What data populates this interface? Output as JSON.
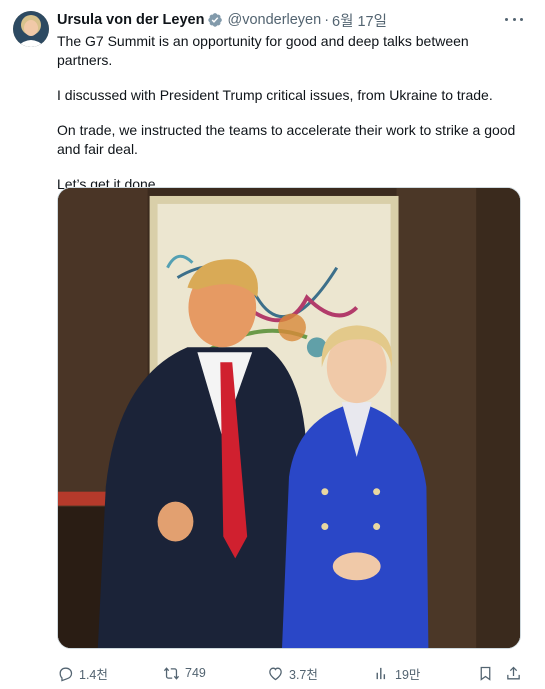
{
  "author": {
    "name": "Ursula von der Leyen",
    "handle": "@vonderleyen",
    "separator": "·",
    "date": "6월 17일",
    "verified_icon": "verified-badge-icon"
  },
  "tweet": {
    "paragraphs": [
      "The G7 Summit is an opportunity for good and deep talks between partners.",
      "I discussed with President Trump critical issues, from Ukraine to trade.",
      "On trade, we instructed the teams to accelerate their work to strike a good and fair deal.",
      "Let’s get it done."
    ]
  },
  "actions": {
    "reply": {
      "icon": "reply-icon",
      "count": "1.4천"
    },
    "retweet": {
      "icon": "retweet-icon",
      "count": "749"
    },
    "like": {
      "icon": "heart-icon",
      "count": "3.7천"
    },
    "views": {
      "icon": "views-chart-icon",
      "count": "19만"
    },
    "bookmark": {
      "icon": "bookmark-icon"
    },
    "share": {
      "icon": "share-icon"
    }
  },
  "colors": {
    "text": "#0f1419",
    "muted": "#536471",
    "verified": "#829aab"
  }
}
